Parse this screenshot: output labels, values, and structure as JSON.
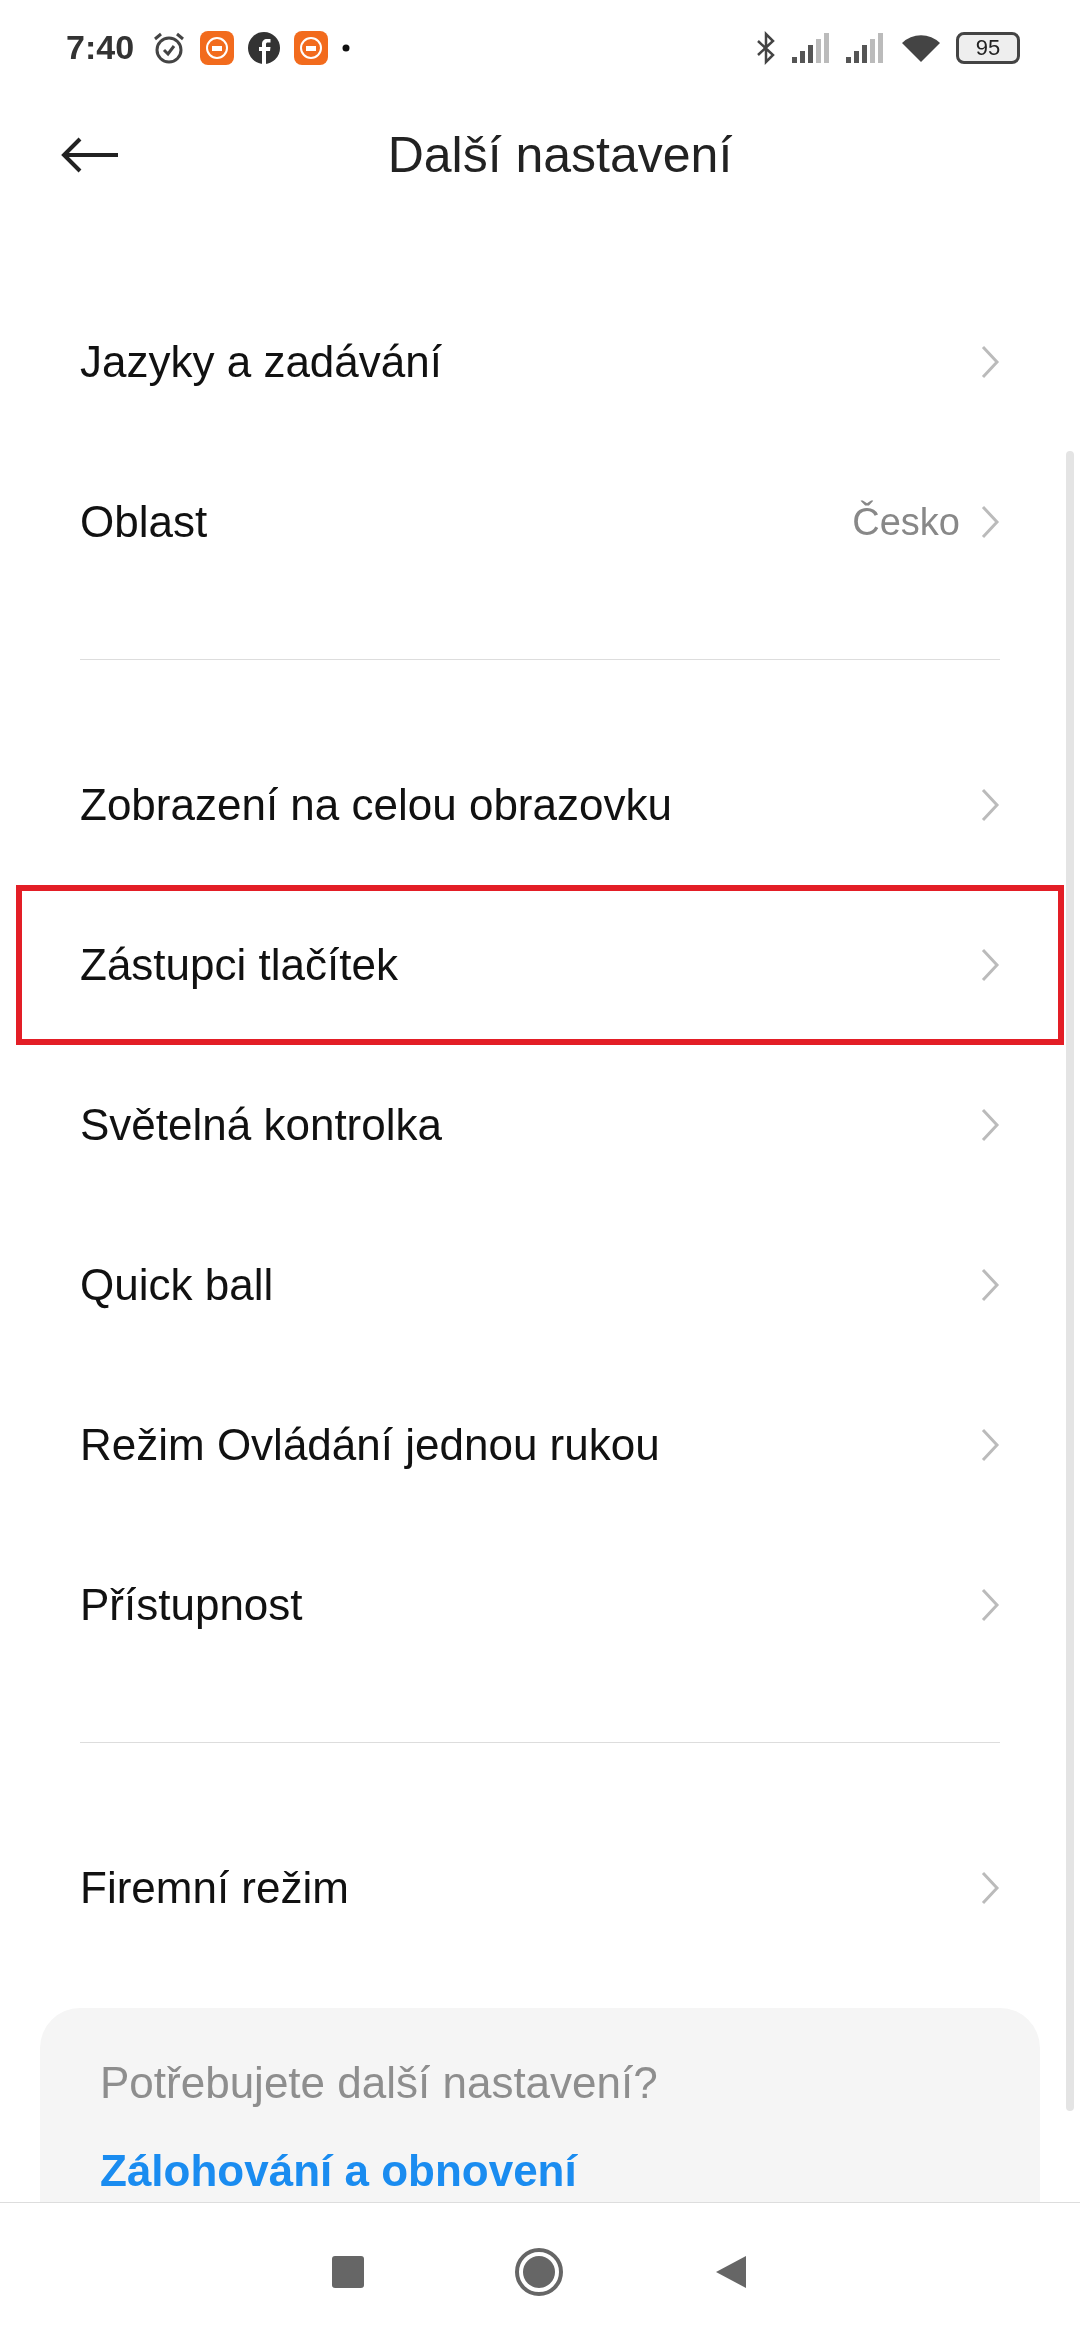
{
  "status_bar": {
    "time": "7:40",
    "battery": "95"
  },
  "header": {
    "title": "Další nastavení"
  },
  "groups": [
    {
      "items": [
        {
          "label": "Jazyky a zadávání",
          "highlighted": false
        },
        {
          "label": "Oblast",
          "value": "Česko",
          "highlighted": false
        }
      ]
    },
    {
      "items": [
        {
          "label": "Zobrazení na celou obrazovku",
          "highlighted": false
        },
        {
          "label": "Zástupci tlačítek",
          "highlighted": true
        },
        {
          "label": "Světelná kontrolka",
          "highlighted": false
        },
        {
          "label": "Quick ball",
          "highlighted": false
        },
        {
          "label": "Režim Ovládání jednou rukou",
          "highlighted": false
        },
        {
          "label": "Přístupnost",
          "highlighted": false
        }
      ]
    },
    {
      "items": [
        {
          "label": "Firemní režim",
          "highlighted": false
        }
      ]
    }
  ],
  "card": {
    "question": "Potřebujete další nastavení?",
    "link": "Zálohování a obnovení"
  }
}
